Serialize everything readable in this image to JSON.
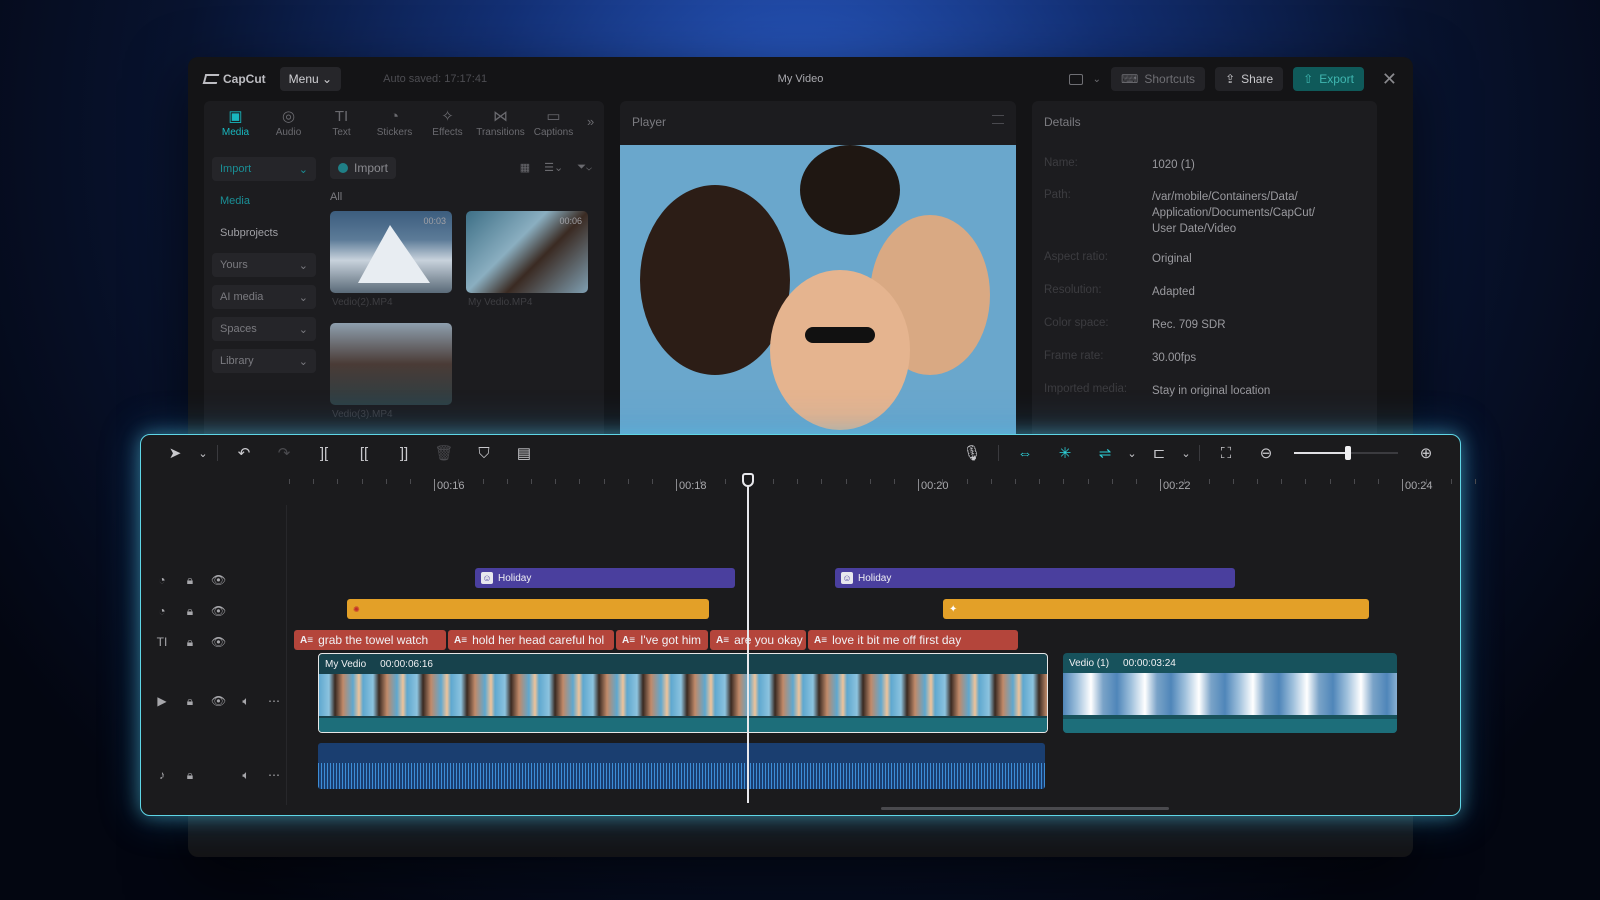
{
  "app": {
    "brand": "CapCut",
    "menu_label": "Menu",
    "autosave": "Auto saved: 17:17:41",
    "window_title": "My Video",
    "shortcuts_label": "Shortcuts",
    "share_label": "Share",
    "export_label": "Export"
  },
  "tool_tabs": [
    {
      "label": "Media",
      "icon": "media-icon",
      "active": true
    },
    {
      "label": "Audio",
      "icon": "audio-icon"
    },
    {
      "label": "Text",
      "icon": "text-icon"
    },
    {
      "label": "Stickers",
      "icon": "stickers-icon"
    },
    {
      "label": "Effects",
      "icon": "effects-icon"
    },
    {
      "label": "Transitions",
      "icon": "transitions-icon"
    },
    {
      "label": "Captions",
      "icon": "captions-icon"
    }
  ],
  "side_nav": [
    {
      "label": "Import"
    },
    {
      "label": "Media"
    },
    {
      "label": "Subprojects"
    },
    {
      "label": "Yours"
    },
    {
      "label": "AI media"
    },
    {
      "label": "Spaces"
    },
    {
      "label": "Library"
    }
  ],
  "media": {
    "import_label": "Import",
    "filter_label": "All",
    "items": [
      {
        "name": "Vedio(2).MP4",
        "duration": "00:03"
      },
      {
        "name": "My Vedio.MP4",
        "duration": "00:06"
      },
      {
        "name": "Vedio(3).MP4",
        "duration": ""
      }
    ]
  },
  "player": {
    "title": "Player"
  },
  "details": {
    "title": "Details",
    "rows": [
      {
        "key": "Name:",
        "value": "1020 (1)"
      },
      {
        "key": "Path:",
        "value": "/var/mobile/Containers/Data/ Application/Documents/CapCut/ User Date/Video"
      },
      {
        "key": "Aspect ratio:",
        "value": "Original"
      },
      {
        "key": "Resolution:",
        "value": "Adapted"
      },
      {
        "key": "Color space:",
        "value": "Rec. 709 SDR"
      },
      {
        "key": "Frame rate:",
        "value": "30.00fps"
      },
      {
        "key": "Imported media:",
        "value": "Stay in original location"
      }
    ]
  },
  "timeline": {
    "zoom_level": 0.52,
    "ruler_labels": [
      "00:16",
      "00:18",
      "00:20",
      "00:22",
      "00:24"
    ],
    "sticker_track": [
      {
        "label": "Holiday"
      },
      {
        "label": "Holiday"
      }
    ],
    "caption_track": [
      "grab the towel watch",
      "hold her head careful hol",
      "I've got him",
      "are you okay",
      "love it bit me off first day"
    ],
    "video_clips": [
      {
        "name": "My Vedio",
        "duration": "00:00:06:16"
      },
      {
        "name": "Vedio (1)",
        "duration": "00:00:03:24"
      }
    ]
  },
  "colors": {
    "accent": "#18b7be",
    "timeline_glow": "#5fd6e6",
    "sticker_clip": "#4a3f9e",
    "effect_clip": "#e3a028",
    "caption_clip": "#b4453b"
  }
}
